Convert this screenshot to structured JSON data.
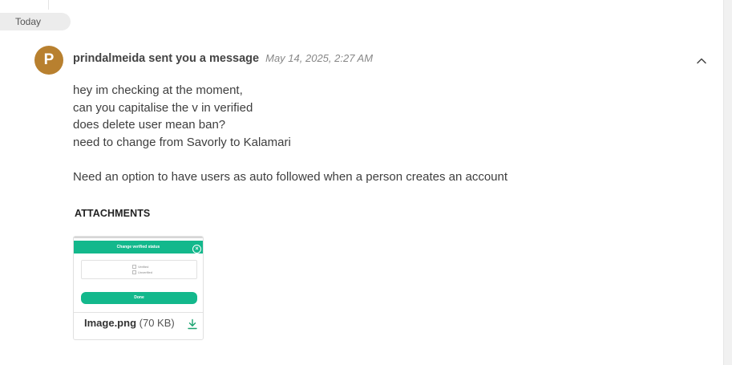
{
  "date_divider": {
    "label": "Today"
  },
  "message": {
    "avatar_initial": "P",
    "avatar_color": "#b8802f",
    "header": "prindalmeida sent you a message",
    "timestamp": "May 14, 2025, 2:27 AM",
    "collapse_icon": "chevron-up-icon",
    "lines": [
      "hey im checking at the moment,",
      "can you capitalise the v in verified",
      "does delete user mean ban?",
      "need to change from Savorly to Kalamari",
      "Need an option to have users as auto followed when a person creates an account"
    ]
  },
  "attachments": {
    "heading": "ATTACHMENTS",
    "items": [
      {
        "name": "Image.png",
        "size": "(70 KB)",
        "download_icon": "download-icon",
        "preview": {
          "title": "Change verified status",
          "options": [
            "Verified",
            "Unverified"
          ],
          "button": "Done",
          "accent": "#13b88c"
        }
      }
    ]
  },
  "colors": {
    "accent": "#13b88c",
    "download": "#1aa36f"
  }
}
